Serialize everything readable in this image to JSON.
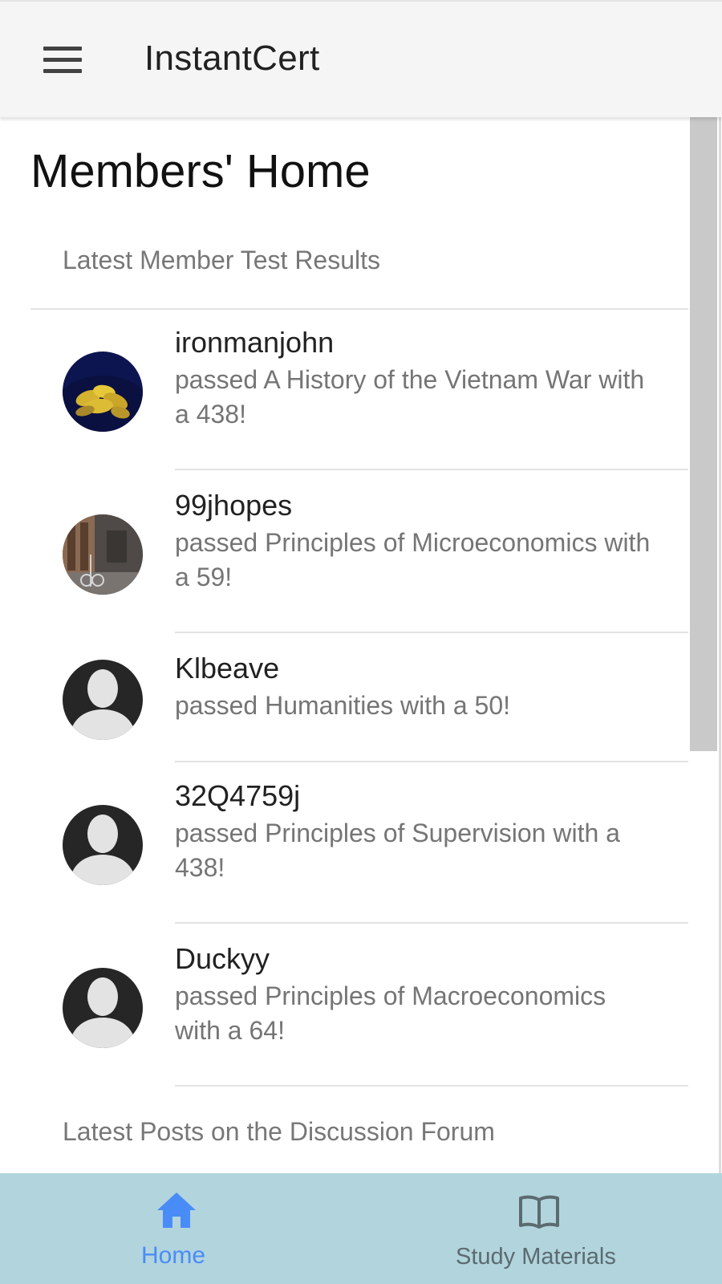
{
  "app": {
    "title": "InstantCert"
  },
  "page": {
    "title": "Members' Home"
  },
  "sections": {
    "test_results": "Latest Member Test Results",
    "forum": "Latest Posts on the Discussion Forum"
  },
  "results": [
    {
      "user": "ironmanjohn",
      "text": "passed A History of the Vietnam War with a 438!",
      "avatar": "bananas-photo"
    },
    {
      "user": "99jhopes",
      "text": "passed Principles of Microeconomics with a 59!",
      "avatar": "street-photo"
    },
    {
      "user": "Klbeave",
      "text": "passed Humanities with a 50!",
      "avatar": "default-person"
    },
    {
      "user": "32Q4759j",
      "text": "passed Principles of Supervision with a 438!",
      "avatar": "default-person"
    },
    {
      "user": "Duckyy",
      "text": "passed Principles of Macroeconomics with a 64!",
      "avatar": "default-person"
    }
  ],
  "bottom_nav": {
    "items": [
      {
        "label": "Home",
        "icon": "home-icon",
        "active": true
      },
      {
        "label": "Study Materials",
        "icon": "book-open-icon",
        "active": false
      }
    ],
    "active_color": "#4a8cf7",
    "inactive_color": "#5b6b70",
    "background": "#b2d4dd"
  }
}
